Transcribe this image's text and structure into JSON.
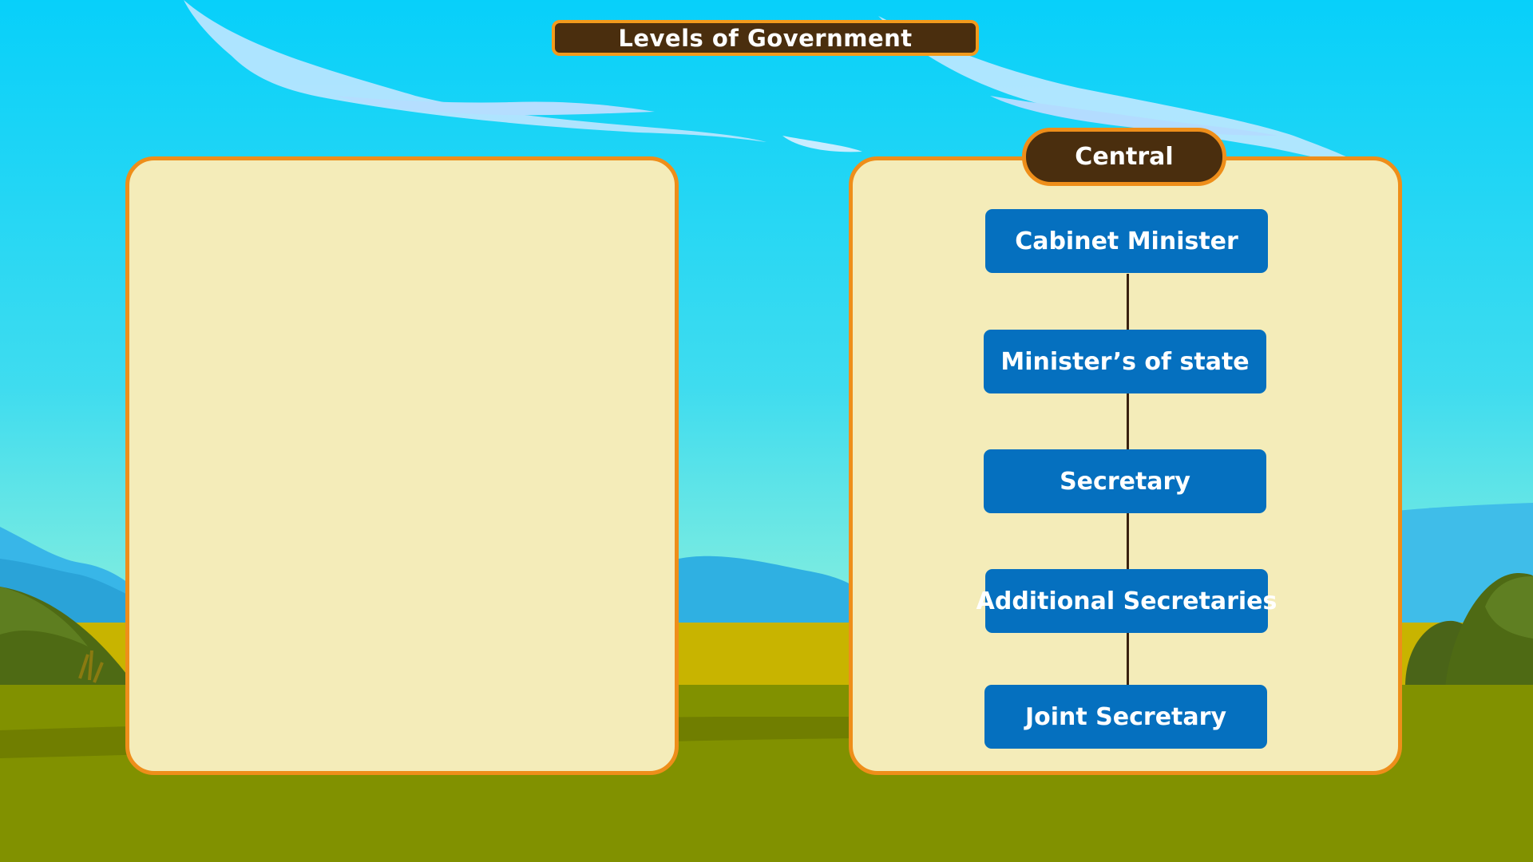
{
  "title": "Levels of Government",
  "left_panel": {},
  "right_panel": {
    "tab_label": "Central",
    "hierarchy": [
      "Cabinet Minister",
      "Minister’s of state",
      "Secretary",
      "Additional Secretaries",
      "Joint Secretary"
    ]
  },
  "colors": {
    "panel_fill": "#f4ecb9",
    "panel_border": "#ee8e1a",
    "plaque": "#4a2e0e",
    "node": "#0570bf",
    "connector": "#3a2210"
  }
}
